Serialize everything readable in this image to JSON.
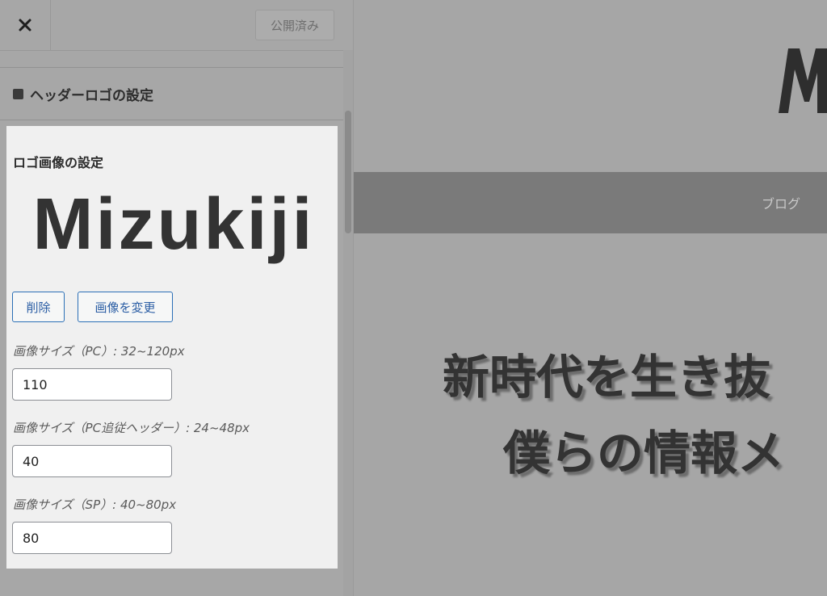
{
  "header": {
    "close_glyph": "✕",
    "publish_label": "公開済み"
  },
  "section": {
    "title": "ヘッダーロゴの設定"
  },
  "logo_control": {
    "label": "ロゴ画像の設定",
    "logo_text": "Mizukiji",
    "delete_label": "削除",
    "change_label": "画像を変更"
  },
  "fields": [
    {
      "label": "画像サイズ（PC）: 32~120px",
      "value": "110"
    },
    {
      "label": "画像サイズ（PC追従ヘッダー）: 24~48px",
      "value": "40"
    },
    {
      "label": "画像サイズ（SP）: 40~80px",
      "value": "80"
    }
  ],
  "preview": {
    "nav_item": "ブログ",
    "hero_line1": "新時代を生き抜",
    "hero_line2": "僕らの情報メ"
  },
  "colors": {
    "panel_bg": "#a7a7a7",
    "control_bg": "#f0f0f0",
    "button_accent": "#2b6fb6",
    "nav_bg": "#7a7a7a"
  },
  "icons": [
    "close-icon",
    "square-icon"
  ]
}
